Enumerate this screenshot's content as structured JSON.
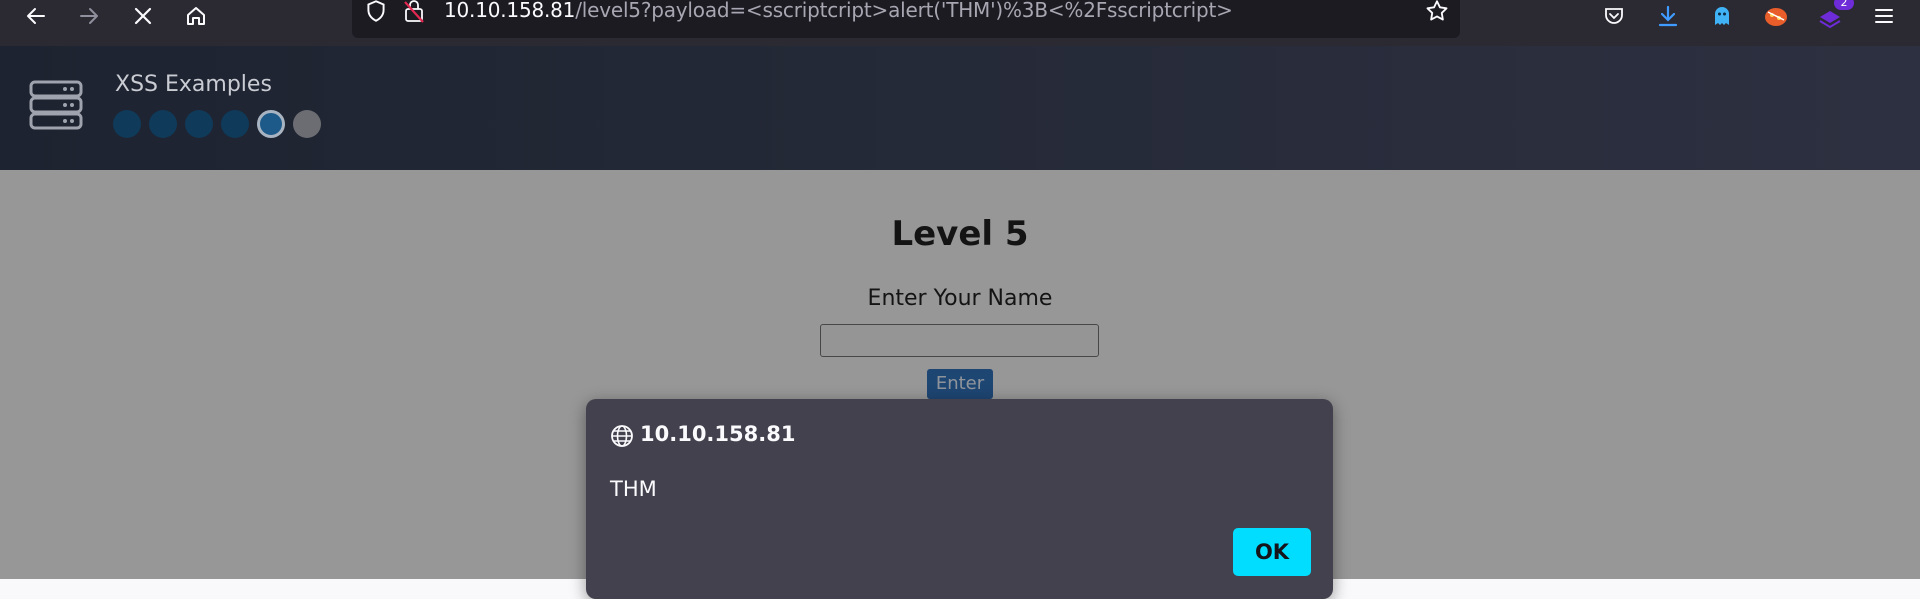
{
  "browser": {
    "url_host": "10.10.158.81",
    "url_path": "/level5?payload=<sscriptcript>alert('THM')%3B<%2Fsscriptcript>",
    "download_badge_count": "2"
  },
  "site": {
    "title": "XSS Examples",
    "progress": {
      "total_levels": 6,
      "current_level": 5
    }
  },
  "page": {
    "level_title": "Level 5",
    "name_label": "Enter Your Name",
    "name_input_value": "",
    "enter_button_label": "Enter"
  },
  "dialog": {
    "origin": "10.10.158.81",
    "message": "THM",
    "ok_label": "OK"
  },
  "colors": {
    "dialog_bg": "#42414d",
    "ok_button": "#00ddff",
    "enter_button": "#2a6db8"
  }
}
